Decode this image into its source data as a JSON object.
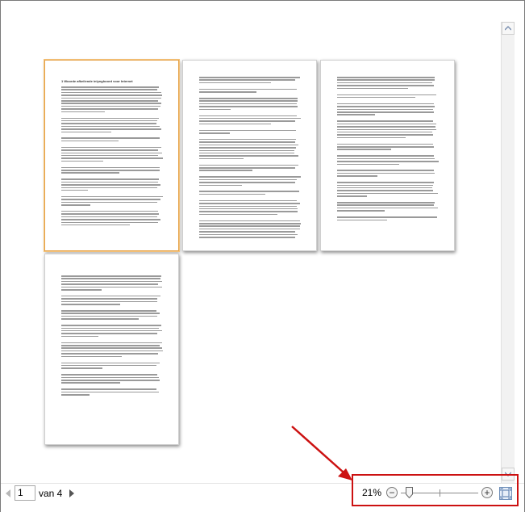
{
  "pages": {
    "page1_heading": "1   Woorde afkeilende inlynghoord voor Internet"
  },
  "navigation": {
    "current_page": "1",
    "page_of_label": "van 4"
  },
  "zoom": {
    "percent_label": "21%",
    "minus_label": "−",
    "plus_label": "+",
    "level_percent": 21
  },
  "icons": {
    "previous": "triangle-left-icon",
    "next": "triangle-right-icon",
    "scroll_up": "chevron-up-icon",
    "scroll_down": "chevron-down-icon",
    "fit": "fit-page-icon"
  },
  "colors": {
    "highlight_box": "#cc1111",
    "annotation_arrow": "#cc1111",
    "selected_page_border": "#e6a34a"
  }
}
